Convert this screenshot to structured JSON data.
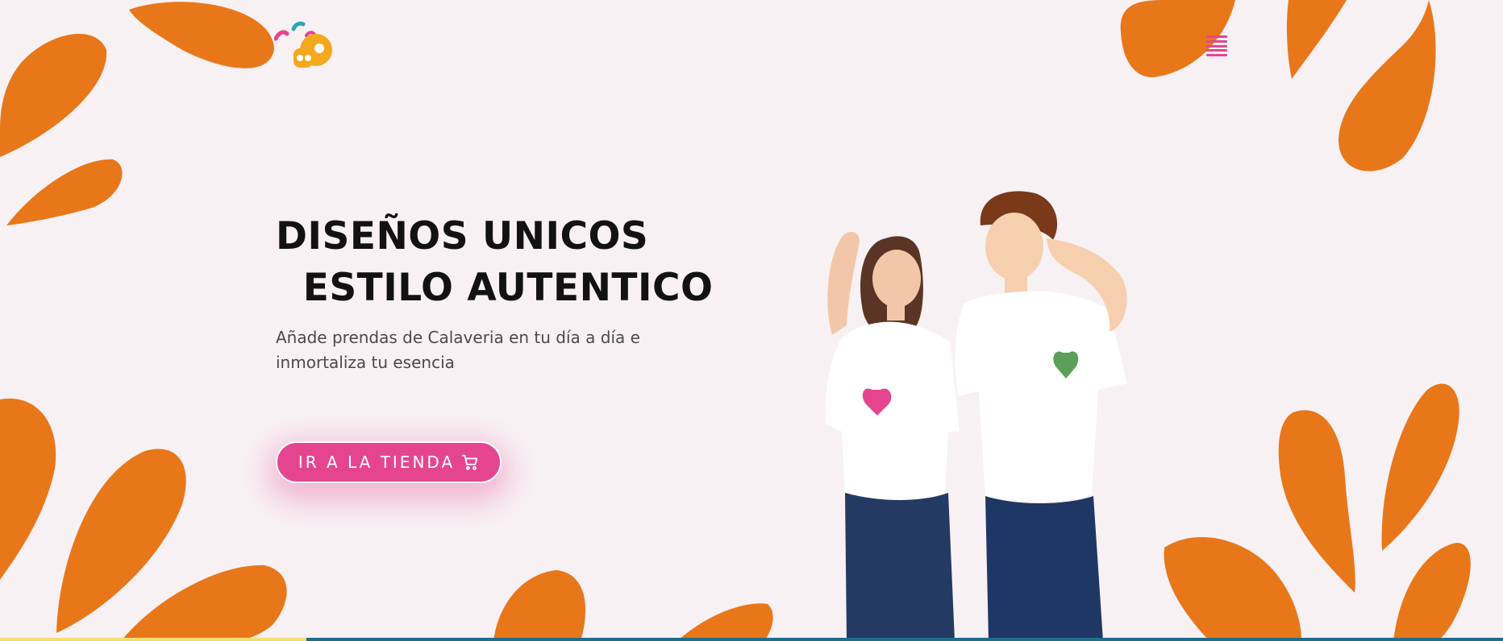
{
  "hero": {
    "title_line1": "DISEÑOS UNICOS",
    "title_line2": "  ESTILO AUTENTICO",
    "subtitle": "Añade prendas de Calaveria en tu día a día e inmortaliza tu esencia"
  },
  "cta": {
    "label": "IR A LA TIENDA",
    "icon": "shopping-cart-icon"
  },
  "icons": {
    "logo": "calaveria-skull-logo",
    "menu": "hamburger-menu-icon"
  },
  "colors": {
    "background": "#f8f1f4",
    "petal_orange": "#e8771a",
    "accent_pink": "#e5458f",
    "title": "#121212",
    "text": "#4a4a4a"
  }
}
